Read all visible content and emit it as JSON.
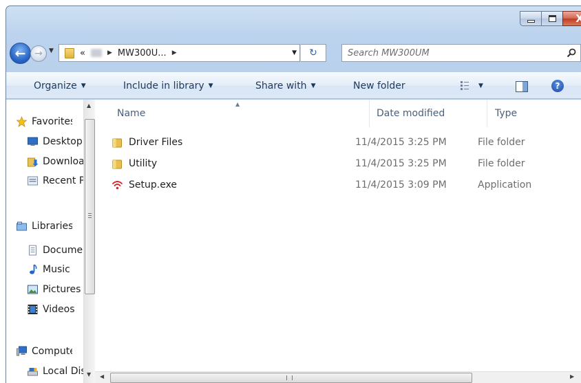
{
  "window": {
    "caption": {
      "close_label": "X"
    }
  },
  "address": {
    "breadcrumb_overflow": "«",
    "current_folder": "MW300U...",
    "refresh_glyph": "↻"
  },
  "search": {
    "placeholder": "Search MW300UM"
  },
  "toolbar": {
    "organize": "Organize",
    "include_in_library": "Include in library",
    "share_with": "Share with",
    "new_folder": "New folder",
    "help_glyph": "?"
  },
  "navigation": {
    "items": [
      {
        "label": "Favorites",
        "icon": "star-icon"
      },
      {
        "label": "Desktop",
        "icon": "desktop-icon"
      },
      {
        "label": "Downloads",
        "icon": "downloads-icon"
      },
      {
        "label": "Recent Places",
        "icon": "recent-places-icon"
      },
      {
        "label": "Libraries",
        "icon": "libraries-icon"
      },
      {
        "label": "Documents",
        "icon": "documents-icon"
      },
      {
        "label": "Music",
        "icon": "music-icon"
      },
      {
        "label": "Pictures",
        "icon": "pictures-icon"
      },
      {
        "label": "Videos",
        "icon": "videos-icon"
      },
      {
        "label": "Computer",
        "icon": "computer-icon"
      },
      {
        "label": "Local Disk",
        "icon": "local-disk-icon"
      }
    ]
  },
  "file_list": {
    "columns": [
      "Name",
      "Date modified",
      "Type"
    ],
    "rows": [
      {
        "name": "Driver Files",
        "date": "11/4/2015 3:25 PM",
        "type": "File folder",
        "icon": "folder-icon"
      },
      {
        "name": "Utility",
        "date": "11/4/2015 3:25 PM",
        "type": "File folder",
        "icon": "folder-icon"
      },
      {
        "name": "Setup.exe",
        "date": "11/4/2015 3:09 PM",
        "type": "Application",
        "icon": "wifi-setup-icon"
      }
    ]
  },
  "colors": {
    "accent": "#2a67c8",
    "toolbar_text": "#1e395b",
    "header_text": "#4c607a",
    "secondary_text": "#6d6d6d",
    "setup_icon": "#d6262b"
  }
}
